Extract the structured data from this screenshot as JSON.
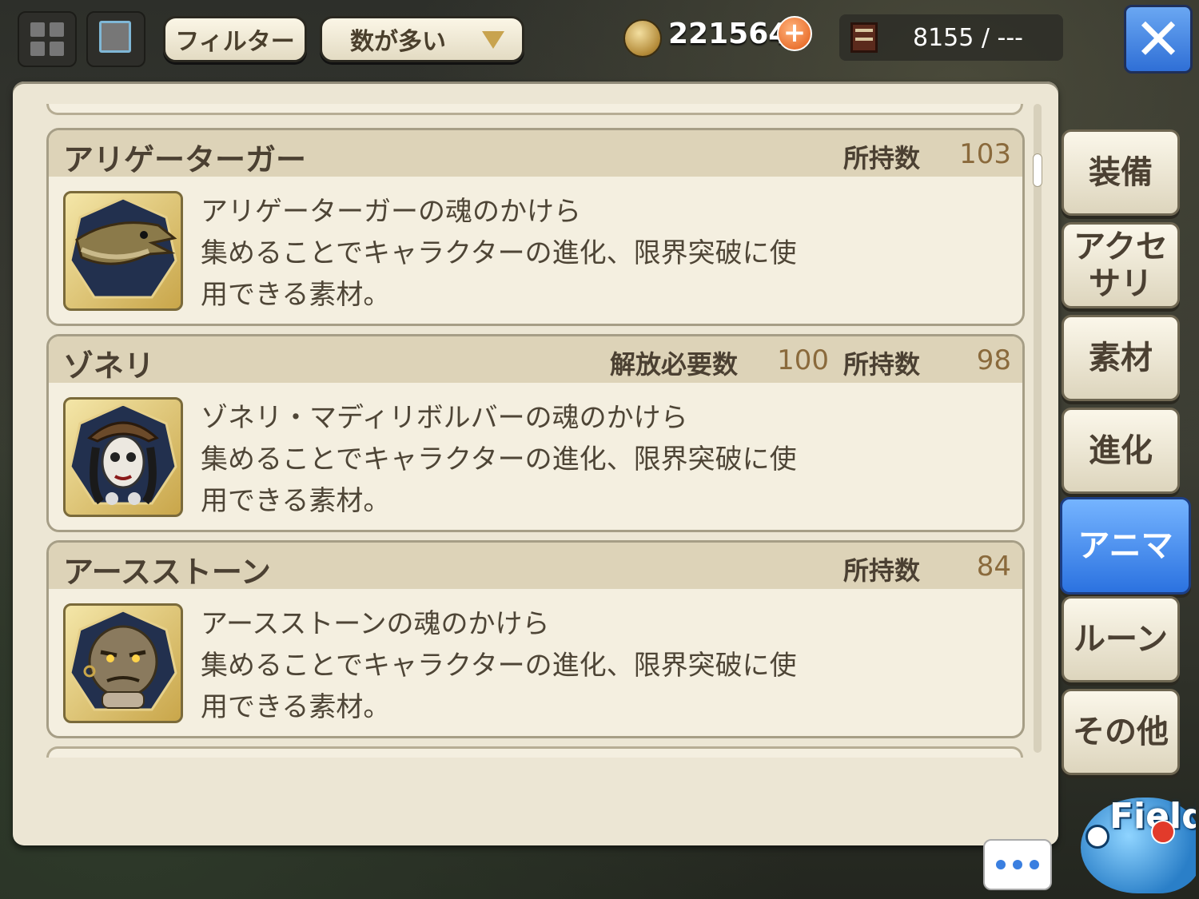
{
  "topbar": {
    "filter_label": "フィルター",
    "sort_label": "数が多い",
    "coins": "221564",
    "plus_symbol": "+",
    "storage": "8155 / ---",
    "close_symbol": "✕"
  },
  "items": [
    {
      "name": "アリゲーターガー",
      "required_label": "",
      "required_value": "",
      "owned_label": "所持数",
      "owned_value": "103",
      "description": "アリゲーターガーの魂のかけら\n集めることでキャラクターの進化、限界突破に使\n用できる素材。",
      "icon": "alligator-gar-icon"
    },
    {
      "name": "ゾネリ",
      "required_label": "解放必要数",
      "required_value": "100",
      "owned_label": "所持数",
      "owned_value": "98",
      "description": "ゾネリ・マディリボルバーの魂のかけら\n集めることでキャラクターの進化、限界突破に使\n用できる素材。",
      "icon": "zoneri-icon"
    },
    {
      "name": "アースストーン",
      "required_label": "",
      "required_value": "",
      "owned_label": "所持数",
      "owned_value": "84",
      "description": "アースストーンの魂のかけら\n集めることでキャラクターの進化、限界突破に使\n用できる素材。",
      "icon": "earth-stone-icon"
    }
  ],
  "tabs": {
    "equipment": "装備",
    "accessory": "アクセ\nサリ",
    "material": "素材",
    "evolution": "進化",
    "anima": "アニマ",
    "rune": "ルーン",
    "other": "その他"
  },
  "field_label": "Field",
  "colors": {
    "active_tab": "#2b72e0",
    "value_text": "#8a6a3c",
    "panel_bg": "#ece6d4"
  }
}
